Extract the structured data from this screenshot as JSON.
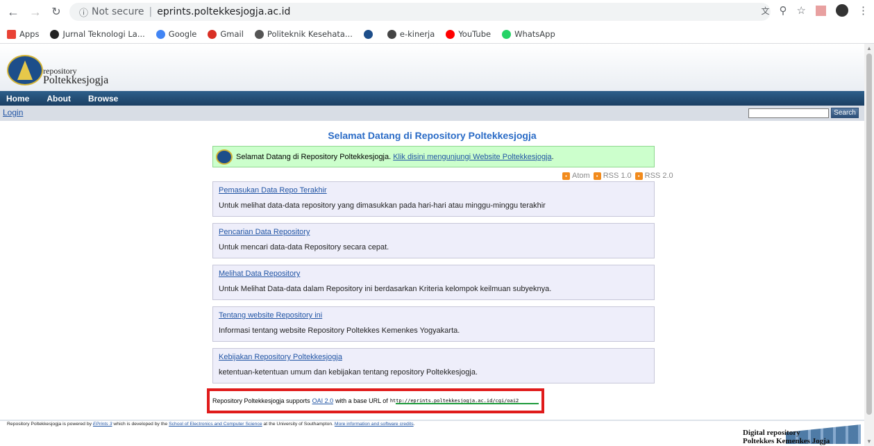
{
  "browser": {
    "security_label": "Not secure",
    "host": "eprints.poltekkesjogja.ac.id",
    "bookmarks": [
      {
        "label": "Apps",
        "color": "#e94235"
      },
      {
        "label": "Jurnal Teknologi La...",
        "color": "#222222"
      },
      {
        "label": "Google",
        "color": "#4285f4"
      },
      {
        "label": "Gmail",
        "color": "#d93025"
      },
      {
        "label": "Politeknik Kesehata...",
        "color": "#555555"
      },
      {
        "label": "",
        "color": "#1d4e8a"
      },
      {
        "label": "e-kinerja",
        "color": "#444444"
      },
      {
        "label": "YouTube",
        "color": "#ff0000"
      },
      {
        "label": "WhatsApp",
        "color": "#25d366"
      }
    ]
  },
  "header": {
    "logo_line1": "repository",
    "logo_line2": "Poltekkesjogja"
  },
  "menu": {
    "items": [
      "Home",
      "About",
      "Browse"
    ]
  },
  "login": {
    "label": "Login",
    "search_button": "Search"
  },
  "main": {
    "title": "Selamat Datang di Repository Poltekkesjogja",
    "welcome_text": "Selamat Datang di Repository Poltekkesjogja.",
    "welcome_link": "Klik disini mengunjungi Website Poltekkesjogja",
    "feeds": [
      "Atom",
      "RSS 1.0",
      "RSS 2.0"
    ],
    "boxes": [
      {
        "link": "Pemasukan Data Repo Terakhir",
        "desc": "Untuk melihat data-data repository yang dimasukkan pada hari-hari atau minggu-minggu terakhir"
      },
      {
        "link": "Pencarian Data Repository",
        "desc": "Untuk mencari data-data Repository secara cepat."
      },
      {
        "link": "Melihat Data Repository",
        "desc": "Untuk Melihat Data-data dalam Repository ini berdasarkan Kriteria kelompok keilmuan subyeknya."
      },
      {
        "link": "Tentang website Repository ini",
        "desc": "Informasi tentang website Repository Poltekkes Kemenkes Yogyakarta."
      },
      {
        "link": "Kebijakan Repository Poltekkesjogja",
        "desc": "ketentuan-ketentuan umum dan kebijakan tentang repository Poltekkesjogja."
      }
    ],
    "oai": {
      "text_before": "Repository Poltekkesjogja supports",
      "link": "OAI 2.0",
      "text_after": "with a base URL of",
      "url": "http://eprints.poltekkesjogja.ac.id/cgi/oai2"
    }
  },
  "footer": {
    "t1": "Repository Poltekkesjogja is powered by",
    "eprints": "EPrints 3",
    "t2": "which is developed by the",
    "school": "School of Electronics and Computer Science",
    "t3": "at the University of Southampton.",
    "more": "More information and software credits",
    "badge_line1": "Digital repository",
    "badge_line2": "Poltekkes Kemenkes Jogja"
  }
}
